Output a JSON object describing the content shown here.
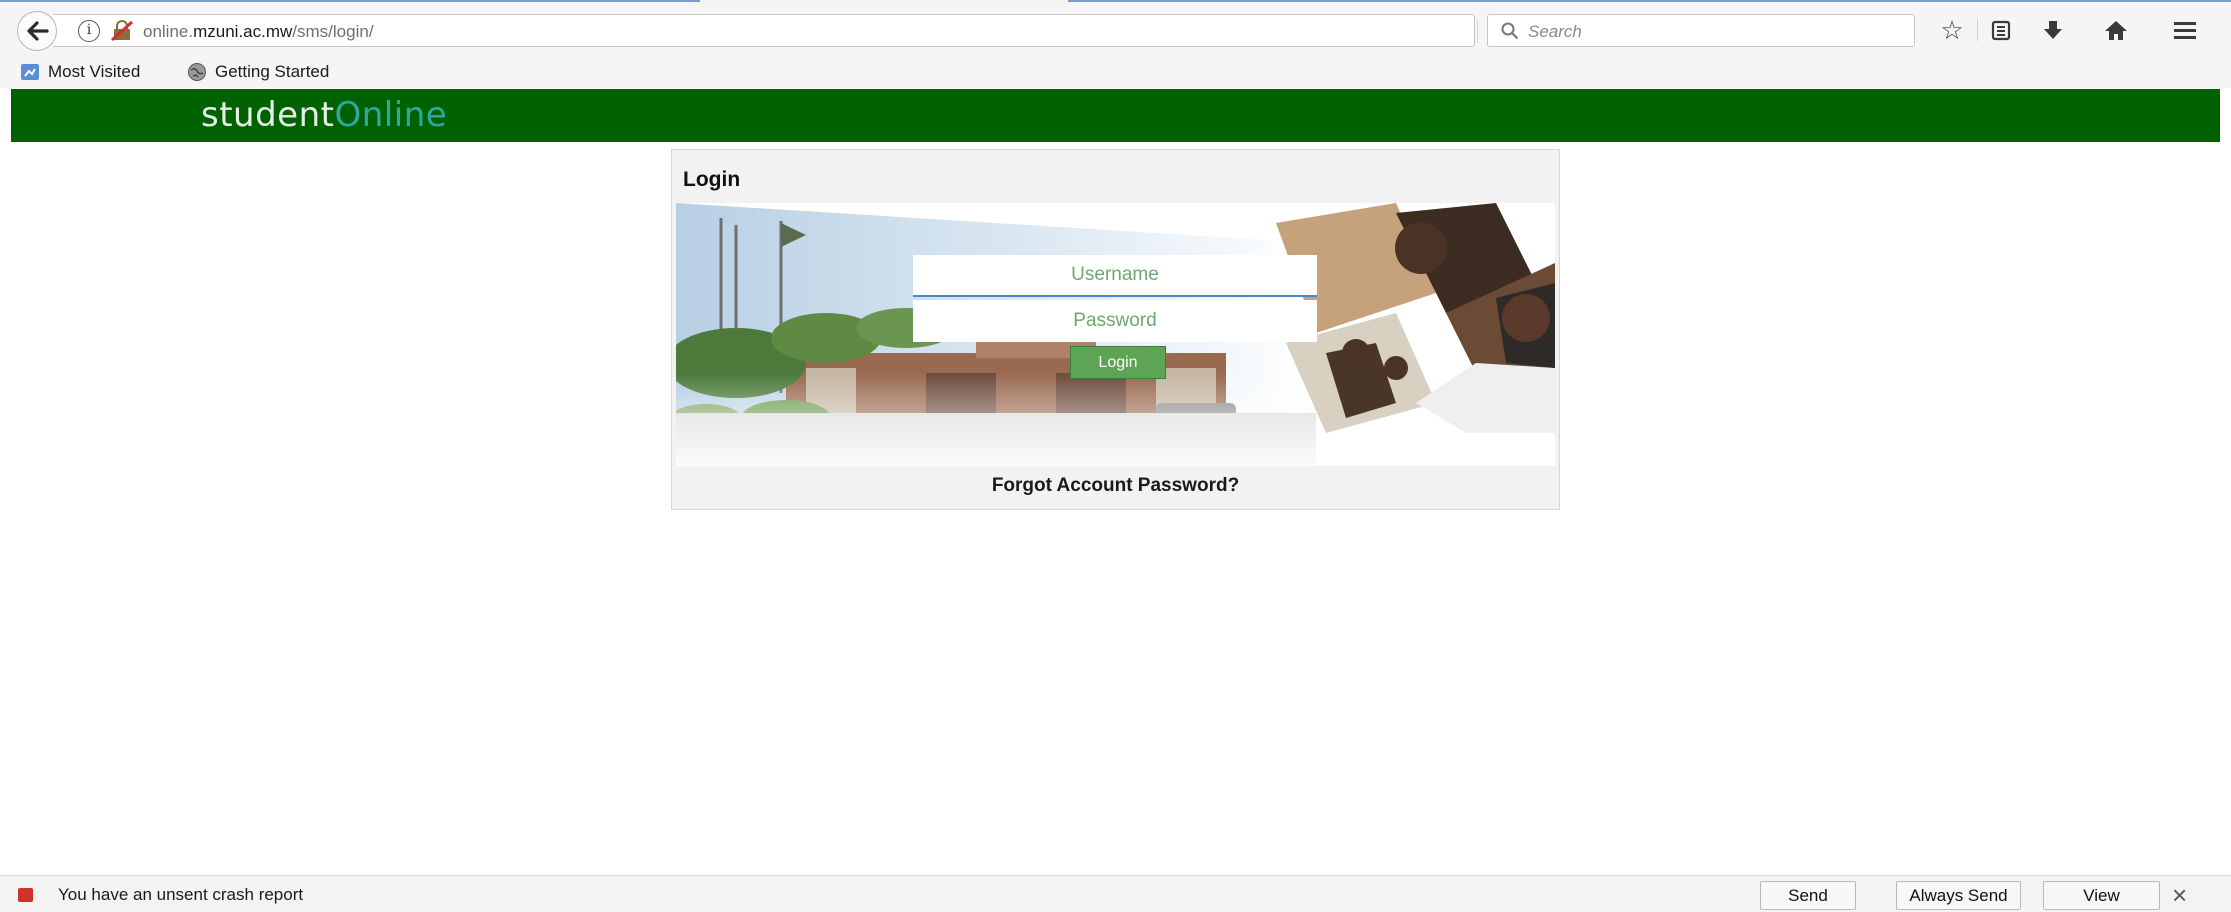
{
  "browser": {
    "url_host_prefix": "online.",
    "url_host_domain": "mzuni.ac.mw",
    "url_path": "/sms/login/",
    "search_placeholder": "Search",
    "bookmarks": [
      "Most Visited",
      "Getting Started"
    ]
  },
  "site": {
    "logo_part1": "student",
    "logo_part2": "Online",
    "header_color": "#006100"
  },
  "login": {
    "title": "Login",
    "username_placeholder": "Username",
    "password_placeholder": "Password",
    "button_label": "Login",
    "forgot_link": "Forgot Account Password?"
  },
  "crash_bar": {
    "message": "You have an unsent crash report",
    "send": "Send",
    "always_send": "Always Send",
    "view": "View"
  }
}
